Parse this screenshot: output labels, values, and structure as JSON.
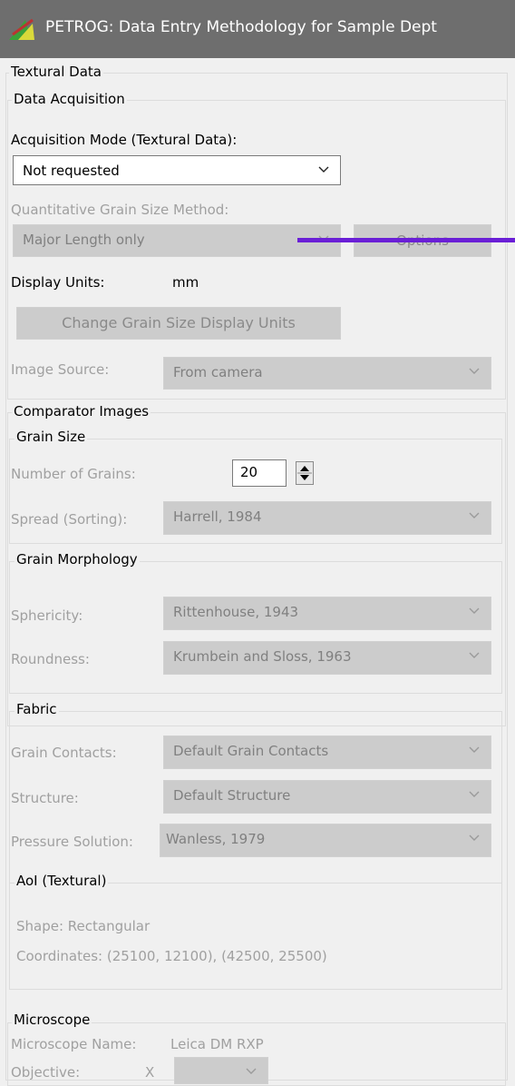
{
  "window": {
    "title": "PETROG: Data Entry Methodology for Sample Dept"
  },
  "textural": {
    "legend": "Textural Data",
    "acquisition": {
      "legend": "Data Acquisition",
      "mode_label": "Acquisition Mode (Textural Data):",
      "mode_value": "Not requested",
      "grain_method_label": "Quantitative Grain Size Method:",
      "grain_method_value": "Major Length only",
      "options_button": "Options",
      "display_units_label": "Display Units:",
      "display_units_value": "mm",
      "change_units_button": "Change Grain Size Display Units",
      "image_source_label": "Image Source:",
      "image_source_value": "From camera"
    },
    "comparator": {
      "legend": "Comparator Images",
      "grain_size": {
        "legend": "Grain Size",
        "num_grains_label": "Number of Grains:",
        "num_grains_value": "20",
        "spread_label": "Spread (Sorting):",
        "spread_value": "Harrell, 1984"
      },
      "morphology": {
        "legend": "Grain Morphology",
        "sphericity_label": "Sphericity:",
        "sphericity_value": "Rittenhouse, 1943",
        "roundness_label": "Roundness:",
        "roundness_value": "Krumbein and Sloss, 1963"
      },
      "fabric": {
        "legend": "Fabric",
        "contacts_label": "Grain Contacts:",
        "contacts_value": "Default Grain Contacts",
        "structure_label": "Structure:",
        "structure_value": "Default Structure",
        "pressure_label": "Pressure Solution:",
        "pressure_value": "Wanless, 1979"
      },
      "aoi": {
        "legend": "AoI (Textural)",
        "shape": "Shape: Rectangular",
        "coordinates": "Coordinates: (25100, 12100), (42500, 25500)"
      }
    }
  },
  "microscope": {
    "legend": "Microscope",
    "name_label": "Microscope Name:",
    "name_value": "Leica DM RXP",
    "objective_label": "Objective:",
    "objective_x": "X"
  },
  "colors": {
    "annotation_line": "#6a1fd6",
    "titlebar": "#6e6e6e"
  }
}
